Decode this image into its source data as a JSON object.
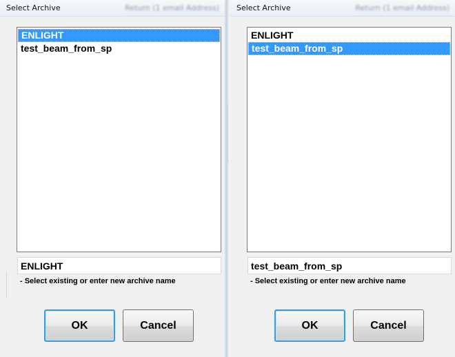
{
  "dialogs": [
    {
      "title": "Select Archive",
      "blurred_title_text": "Return (1 email Address)",
      "list_items": [
        {
          "label": "ENLIGHT",
          "selected": true
        },
        {
          "label": "test_beam_from_sp",
          "selected": false
        }
      ],
      "name_field_value": "ENLIGHT",
      "hint": "- Select existing or enter new archive name",
      "ok_label": "OK",
      "cancel_label": "Cancel"
    },
    {
      "title": "Select Archive",
      "blurred_title_text": "Return (1 email Address)",
      "list_items": [
        {
          "label": "ENLIGHT",
          "selected": false
        },
        {
          "label": "test_beam_from_sp",
          "selected": true
        }
      ],
      "name_field_value": "test_beam_from_sp",
      "hint": "- Select existing or enter new archive name",
      "ok_label": "OK",
      "cancel_label": "Cancel"
    }
  ],
  "colors": {
    "selection": "#3399ff",
    "button_focus": "#3c9bd7"
  }
}
